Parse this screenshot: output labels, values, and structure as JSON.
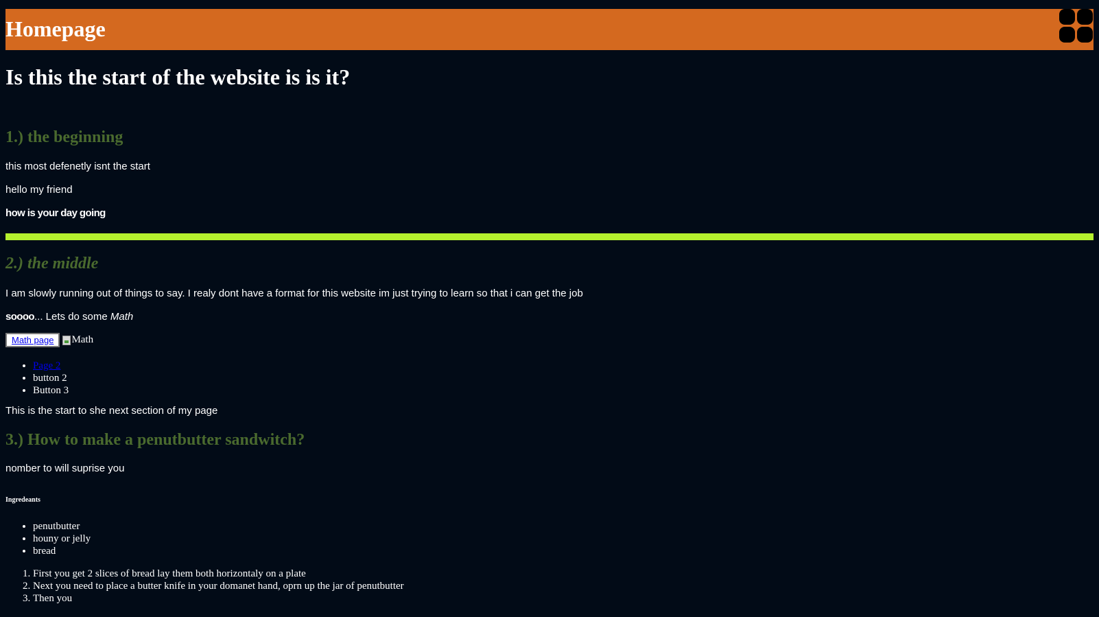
{
  "header": {
    "title": "Homepage",
    "bg_color": "#d4691f"
  },
  "main_title": "Is this the start of the website is is it?",
  "section1": {
    "heading": "1.) the beginning",
    "lines": [
      "this most defenetly isnt the start",
      "hello my friend",
      "how is your day going"
    ]
  },
  "section2": {
    "heading": "2.) the middle",
    "paragraph": "I am slowly running out of things to say. I realy dont have a format for this website im just trying to learn so that i can get the job",
    "soooo_prefix": "soooo",
    "soooo_mid": "... Lets do some ",
    "soooo_em": "Math",
    "math_button": "Math page",
    "math_image_alt": "Math",
    "nav_items": [
      "Page 2",
      "button 2",
      "Button 3"
    ],
    "next_section": "This is the start to she next section of my page"
  },
  "section3": {
    "heading": "3.) How to make a penutbutter sandwitch?",
    "teaser": "nomber to will suprise you",
    "ingredients_heading": "Ingredeants",
    "ingredients": [
      "penutbutter",
      "houny or jelly",
      "bread"
    ],
    "steps": [
      "First you get 2 slices of bread lay them both horizontaly on a plate",
      "Next you need to place a butter knife in your domanet hand, oprn up the jar of penutbutter",
      "Then you"
    ]
  },
  "colors": {
    "background": "#020b17",
    "heading_green": "#4a6a2e",
    "divider_lime": "#b5f02e",
    "link_blue": "#0000ee"
  }
}
